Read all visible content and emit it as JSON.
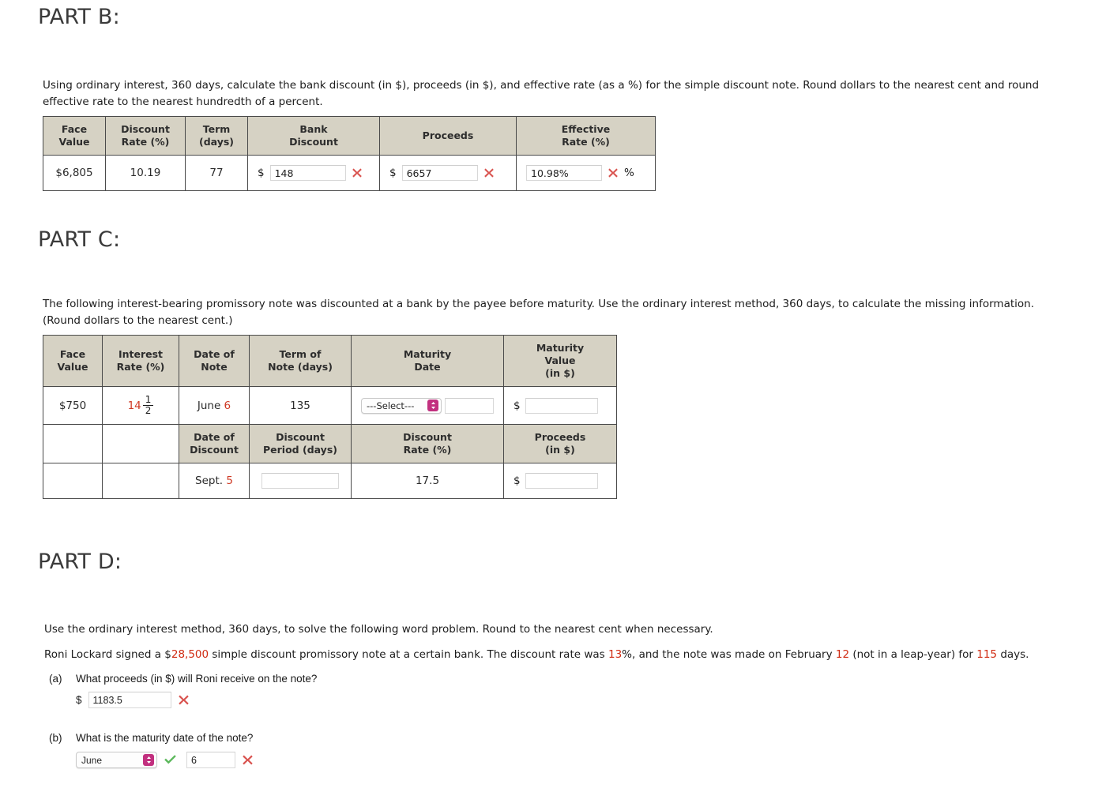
{
  "colors": {
    "header_bg": "#d6d2c4",
    "red_value": "#cf3a25",
    "wrong_x": "#d9534f",
    "correct_check": "#5cb85c",
    "select_spinner": "#c2307f"
  },
  "part_b": {
    "heading": "PART B:",
    "prompt": "Using ordinary interest, 360 days, calculate the bank discount (in $), proceeds (in $), and effective rate (as a %) for the simple discount note. Round dollars to the nearest cent and round effective rate to the nearest hundredth of a percent.",
    "table": {
      "headers": [
        "Face\nValue",
        "Discount\nRate (%)",
        "Term\n(days)",
        "Bank\nDiscount",
        "Proceeds",
        "Effective\nRate (%)"
      ],
      "headers_flat": [
        {
          "line1": "Face",
          "line2": "Value"
        },
        {
          "line1": "Discount",
          "line2": "Rate (%)"
        },
        {
          "line1": "Term",
          "line2": "(days)"
        },
        {
          "line1": "Bank",
          "line2": "Discount"
        },
        {
          "line1": "Proceeds",
          "line2": ""
        },
        {
          "line1": "Effective",
          "line2": "Rate (%)"
        }
      ],
      "row": {
        "face_value": "$6,805",
        "discount_rate": "10.19",
        "term_days": "77",
        "bank_discount_prefix": "$",
        "bank_discount_value": "148",
        "bank_discount_status": "incorrect",
        "proceeds_prefix": "$",
        "proceeds_value": "6657",
        "proceeds_status": "incorrect",
        "effective_rate_value": "10.98%",
        "effective_rate_status": "incorrect",
        "effective_rate_suffix": "%"
      }
    }
  },
  "part_c": {
    "heading": "PART C:",
    "prompt": "The following interest-bearing promissory note was discounted at a bank by the payee before maturity. Use the ordinary interest method, 360 days, to calculate the missing information. (Round dollars to the nearest cent.)",
    "table_top": {
      "headers": [
        {
          "line1": "Face",
          "line2": "Value",
          "line3": ""
        },
        {
          "line1": "Interest",
          "line2": "Rate (%)",
          "line3": ""
        },
        {
          "line1": "Date of",
          "line2": "Note",
          "line3": ""
        },
        {
          "line1": "Term of",
          "line2": "Note (days)",
          "line3": ""
        },
        {
          "line1": "Maturity",
          "line2": "Date",
          "line3": ""
        },
        {
          "line1": "Maturity",
          "line2": "Value",
          "line3": "(in $)"
        }
      ],
      "row": {
        "face_value": "$750",
        "interest_rate_whole": "14",
        "interest_rate_num": "1",
        "interest_rate_den": "2",
        "date_of_note_month": "June",
        "date_of_note_day": "6",
        "term_of_note": "135",
        "maturity_date_select": "---Select---",
        "maturity_date_day": "",
        "maturity_value_prefix": "$",
        "maturity_value": ""
      }
    },
    "table_bottom": {
      "headers": [
        {
          "line1": "Date of",
          "line2": "Discount"
        },
        {
          "line1": "Discount",
          "line2": "Period (days)"
        },
        {
          "line1": "Discount",
          "line2": "Rate (%)"
        },
        {
          "line1": "Proceeds",
          "line2": "(in $)"
        }
      ],
      "row": {
        "date_of_discount_month": "Sept.",
        "date_of_discount_day": "5",
        "discount_period": "",
        "discount_rate": "17.5",
        "proceeds_prefix": "$",
        "proceeds_value": ""
      }
    }
  },
  "part_d": {
    "heading": "PART D:",
    "prompt_line1": "Use the ordinary interest method, 360 days, to solve the following word problem. Round to the nearest cent when necessary.",
    "prompt_line2": {
      "t1": "Roni Lockard signed a $",
      "v1": "28,500",
      "t2": " simple discount promissory note at a certain bank. The discount rate was ",
      "v2": "13",
      "t3": "%, and the note was made on February ",
      "v3": "12",
      "t4": " (not in a leap-year) for ",
      "v4": "115",
      "t5": " days."
    },
    "questions": [
      {
        "label": "(a)",
        "text": "What proceeds (in $) will Roni receive on the note?",
        "answer_prefix": "$",
        "answer_value": "1183.5",
        "status": "incorrect"
      },
      {
        "label": "(b)",
        "text": "What is the maturity date of the note?",
        "select_value": "June",
        "select_status": "correct",
        "day_value": "6",
        "day_status": "incorrect"
      }
    ]
  }
}
